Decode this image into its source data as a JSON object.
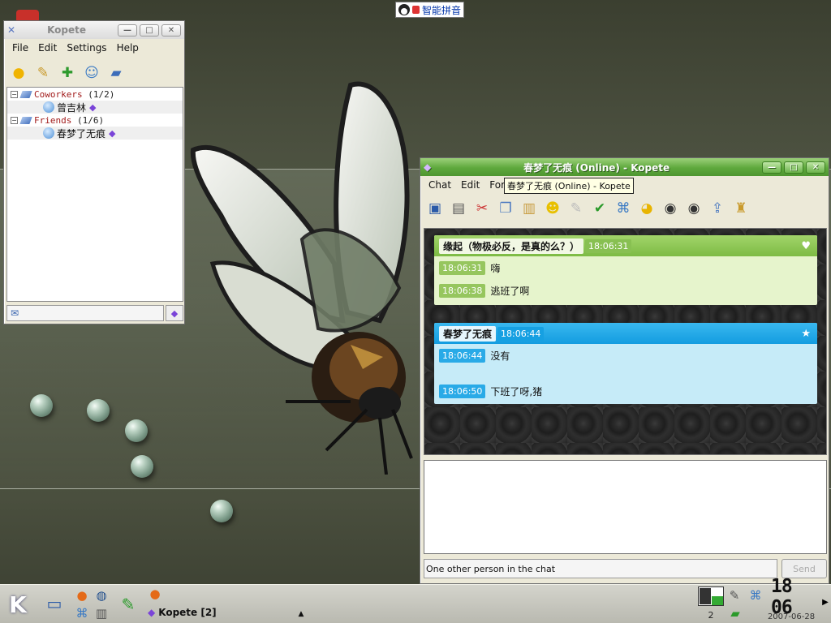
{
  "ime": {
    "label": "智能拼音"
  },
  "kopete_main": {
    "title": "Kopete",
    "menu": [
      "File",
      "Edit",
      "Settings",
      "Help"
    ],
    "groups": [
      {
        "name": "Coworkers",
        "count": "(1/2)",
        "contacts": [
          "曾吉林"
        ]
      },
      {
        "name": "Friends",
        "count": "(1/6)",
        "contacts": [
          "春梦了无痕"
        ]
      }
    ]
  },
  "chat_window": {
    "title": "春梦了无痕 (Online) - Kopete",
    "menu": [
      "Chat",
      "Edit",
      "Form"
    ],
    "tooltip": "春梦了无痕 (Online) - Kopete",
    "messages": [
      {
        "nick": "缘起（物极必反，是真的么？）",
        "time": "18:06:31",
        "lines": [
          {
            "time": "18:06:31",
            "text": "嗨"
          },
          {
            "time": "18:06:38",
            "text": "逃班了啊"
          }
        ]
      },
      {
        "nick": "春梦了无痕",
        "time": "18:06:44",
        "lines": [
          {
            "time": "18:06:44",
            "text": "没有"
          },
          {
            "time": "18:06:50",
            "text": "下班了呀,猪"
          }
        ]
      }
    ],
    "status": "One other person in the chat",
    "send_label": "Send"
  },
  "taskbar": {
    "task_label": "Kopete [2]",
    "desktop_number": "2",
    "clock": "18 06",
    "date": "2007-06-28",
    "kmenu_label": "K"
  },
  "icons": {
    "kopete_toolbar": [
      "add-contact-icon",
      "edit-icon",
      "add-user-icon",
      "group-icon",
      "address-book-icon"
    ],
    "chat_toolbar": [
      "save-icon",
      "print-icon",
      "cut-icon",
      "copy-icon",
      "paste-icon",
      "smiley-icon",
      "pen-icon",
      "spellcheck-icon",
      "network-icon",
      "duck-icon",
      "disc-icon",
      "disc-add-icon",
      "export-icon",
      "broom-icon"
    ]
  },
  "colors": {
    "active_title": "#5ea83c",
    "green_message": "#7dbb44",
    "blue_message": "#139ce0",
    "group_text": "#a21c1c"
  }
}
